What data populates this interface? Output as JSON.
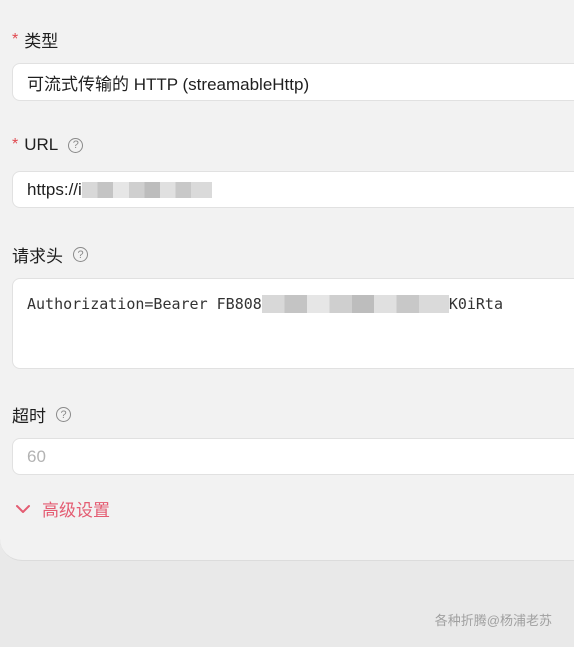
{
  "type_field": {
    "label": "类型",
    "required_mark": "*",
    "value": "可流式传输的 HTTP (streamableHttp)"
  },
  "url_field": {
    "label": "URL",
    "required_mark": "*",
    "help_icon": "question-circle-icon",
    "value_prefix": "https://i"
  },
  "headers_field": {
    "label": "请求头",
    "help_icon": "question-circle-icon",
    "value_prefix": "Authorization=Bearer FB808",
    "value_suffix": "K0iRta"
  },
  "timeout_field": {
    "label": "超时",
    "help_icon": "question-circle-icon",
    "placeholder": "60"
  },
  "advanced": {
    "label": "高级设置",
    "icon": "chevron-down-icon",
    "color": "#e45c72"
  },
  "watermark": "各种折腾@杨浦老苏",
  "colors": {
    "required": "#e0484f",
    "accent": "#e45c72"
  }
}
